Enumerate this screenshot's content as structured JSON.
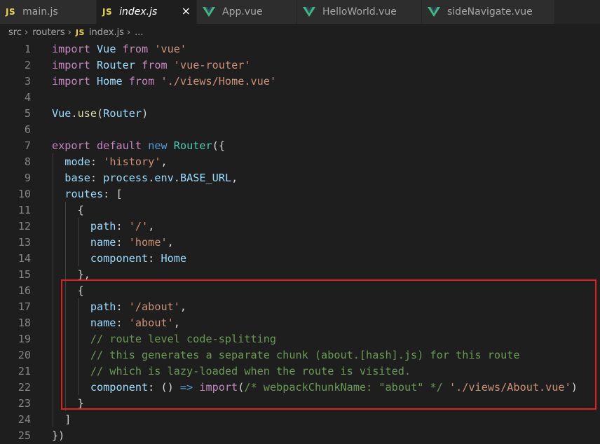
{
  "tabs": [
    {
      "icon": "JS",
      "label": "main.js",
      "active": false
    },
    {
      "icon": "JS",
      "label": "index.js",
      "active": true,
      "close": "×"
    },
    {
      "icon": "vue-icon",
      "label": "App.vue",
      "active": false
    },
    {
      "icon": "vue-icon",
      "label": "HelloWorld.vue",
      "active": false
    },
    {
      "icon": "vue-icon",
      "label": "sideNavigate.vue",
      "active": false
    }
  ],
  "breadcrumb": {
    "parts": [
      "src",
      "routers"
    ],
    "file_icon": "JS",
    "file": "index.js",
    "ellipsis": "..."
  },
  "colors": {
    "keyword": "#569cd6",
    "import_keyword": "#c586c0",
    "variable": "#9cdcfe",
    "string": "#ce9178",
    "function": "#dcdcaa",
    "class": "#4ec9b0",
    "comment": "#6a9955",
    "highlight_box": "#e02020",
    "js_icon": "#e8d44d",
    "vue_icon": "#41b883"
  },
  "editor": {
    "lines": [
      {
        "num": "1",
        "tokens": [
          [
            "c",
            "import"
          ],
          [
            "p",
            " "
          ],
          [
            "v",
            "Vue"
          ],
          [
            "p",
            " "
          ],
          [
            "c",
            "from"
          ],
          [
            "p",
            " "
          ],
          [
            "s",
            "'vue'"
          ]
        ]
      },
      {
        "num": "2",
        "tokens": [
          [
            "c",
            "import"
          ],
          [
            "p",
            " "
          ],
          [
            "v",
            "Router"
          ],
          [
            "p",
            " "
          ],
          [
            "c",
            "from"
          ],
          [
            "p",
            " "
          ],
          [
            "s",
            "'vue-router'"
          ]
        ]
      },
      {
        "num": "3",
        "tokens": [
          [
            "c",
            "import"
          ],
          [
            "p",
            " "
          ],
          [
            "v",
            "Home"
          ],
          [
            "p",
            " "
          ],
          [
            "c",
            "from"
          ],
          [
            "p",
            " "
          ],
          [
            "s",
            "'./views/Home.vue'"
          ]
        ]
      },
      {
        "num": "4",
        "tokens": []
      },
      {
        "num": "5",
        "tokens": [
          [
            "v",
            "Vue"
          ],
          [
            "p",
            "."
          ],
          [
            "f",
            "use"
          ],
          [
            "p",
            "("
          ],
          [
            "v",
            "Router"
          ],
          [
            "p",
            ")"
          ]
        ]
      },
      {
        "num": "6",
        "tokens": []
      },
      {
        "num": "7",
        "tokens": [
          [
            "c",
            "export"
          ],
          [
            "p",
            " "
          ],
          [
            "c",
            "default"
          ],
          [
            "p",
            " "
          ],
          [
            "k",
            "new"
          ],
          [
            "p",
            " "
          ],
          [
            "t",
            "Router"
          ],
          [
            "p",
            "({"
          ]
        ]
      },
      {
        "num": "8",
        "tokens": [
          [
            "p",
            "  "
          ],
          [
            "v",
            "mode"
          ],
          [
            "p",
            ": "
          ],
          [
            "s",
            "'history'"
          ],
          [
            "p",
            ","
          ]
        ]
      },
      {
        "num": "9",
        "tokens": [
          [
            "p",
            "  "
          ],
          [
            "v",
            "base"
          ],
          [
            "p",
            ": "
          ],
          [
            "v",
            "process"
          ],
          [
            "p",
            "."
          ],
          [
            "v",
            "env"
          ],
          [
            "p",
            "."
          ],
          [
            "v",
            "BASE_URL"
          ],
          [
            "p",
            ","
          ]
        ]
      },
      {
        "num": "10",
        "tokens": [
          [
            "p",
            "  "
          ],
          [
            "v",
            "routes"
          ],
          [
            "p",
            ": ["
          ]
        ]
      },
      {
        "num": "11",
        "tokens": [
          [
            "p",
            "    {"
          ]
        ]
      },
      {
        "num": "12",
        "tokens": [
          [
            "p",
            "      "
          ],
          [
            "v",
            "path"
          ],
          [
            "p",
            ": "
          ],
          [
            "s",
            "'/'"
          ],
          [
            "p",
            ","
          ]
        ]
      },
      {
        "num": "13",
        "tokens": [
          [
            "p",
            "      "
          ],
          [
            "v",
            "name"
          ],
          [
            "p",
            ": "
          ],
          [
            "s",
            "'home'"
          ],
          [
            "p",
            ","
          ]
        ]
      },
      {
        "num": "14",
        "tokens": [
          [
            "p",
            "      "
          ],
          [
            "v",
            "component"
          ],
          [
            "p",
            ": "
          ],
          [
            "v",
            "Home"
          ]
        ]
      },
      {
        "num": "15",
        "tokens": [
          [
            "p",
            "    },"
          ]
        ]
      },
      {
        "num": "16",
        "tokens": [
          [
            "p",
            "    {"
          ]
        ]
      },
      {
        "num": "17",
        "tokens": [
          [
            "p",
            "      "
          ],
          [
            "v",
            "path"
          ],
          [
            "p",
            ": "
          ],
          [
            "s",
            "'/about'"
          ],
          [
            "p",
            ","
          ]
        ]
      },
      {
        "num": "18",
        "tokens": [
          [
            "p",
            "      "
          ],
          [
            "v",
            "name"
          ],
          [
            "p",
            ": "
          ],
          [
            "s",
            "'about'"
          ],
          [
            "p",
            ","
          ]
        ]
      },
      {
        "num": "19",
        "tokens": [
          [
            "p",
            "      "
          ],
          [
            "cm",
            "// route level code-splitting"
          ]
        ]
      },
      {
        "num": "20",
        "tokens": [
          [
            "p",
            "      "
          ],
          [
            "cm",
            "// this generates a separate chunk (about.[hash].js) for this route"
          ]
        ]
      },
      {
        "num": "21",
        "tokens": [
          [
            "p",
            "      "
          ],
          [
            "cm",
            "// which is lazy-loaded when the route is visited."
          ]
        ]
      },
      {
        "num": "22",
        "tokens": [
          [
            "p",
            "      "
          ],
          [
            "v",
            "component"
          ],
          [
            "p",
            ": () "
          ],
          [
            "k",
            "=>"
          ],
          [
            "p",
            " "
          ],
          [
            "c",
            "import"
          ],
          [
            "p",
            "("
          ],
          [
            "cm",
            "/* webpackChunkName: \"about\" */"
          ],
          [
            "p",
            " "
          ],
          [
            "s",
            "'./views/About.vue'"
          ],
          [
            "p",
            ")"
          ]
        ]
      },
      {
        "num": "23",
        "tokens": [
          [
            "p",
            "    }"
          ]
        ]
      },
      {
        "num": "24",
        "tokens": [
          [
            "p",
            "  ]"
          ]
        ]
      },
      {
        "num": "25",
        "tokens": [
          [
            "p",
            "})"
          ]
        ]
      }
    ]
  }
}
